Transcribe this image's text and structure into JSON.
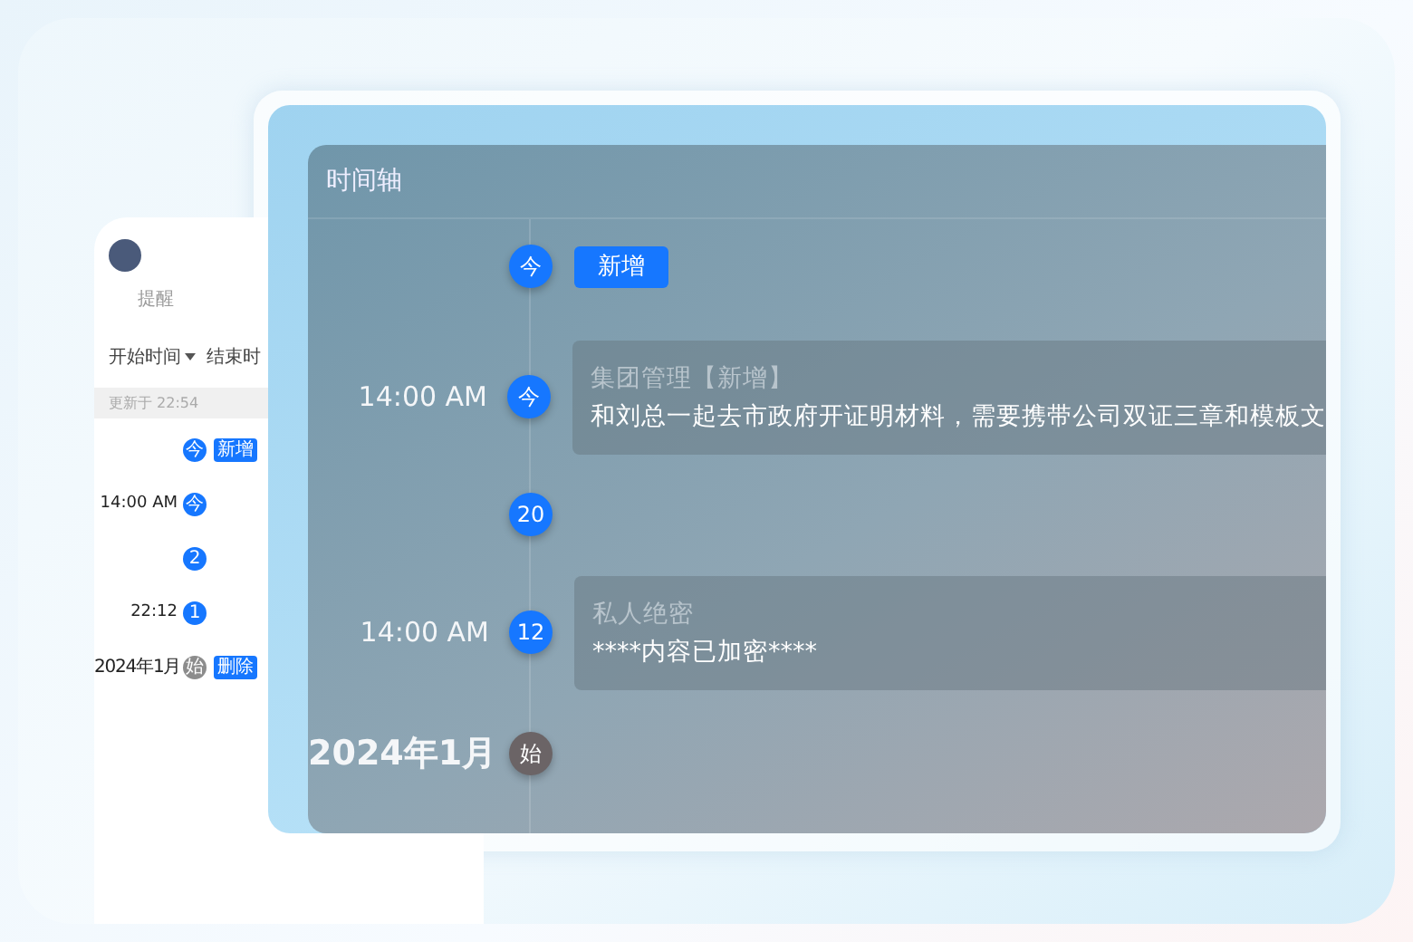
{
  "phone": {
    "tabs": [
      {
        "label": "提醒",
        "selected": false
      }
    ],
    "filters": [
      {
        "label": "开始时间",
        "dropdown": true
      },
      {
        "label": "结束时",
        "dropdown": false
      }
    ],
    "updated": "更新于 22:54",
    "items": [
      {
        "kind": "button",
        "node": "今",
        "color": "#1677ff",
        "label": "新增"
      },
      {
        "kind": "empty",
        "time": "14:00 AM",
        "node": "今",
        "color": "#1677ff"
      },
      {
        "kind": "empty",
        "node": "2",
        "color": "#1677ff"
      },
      {
        "kind": "empty",
        "time": "22:12",
        "node": "1",
        "color": "#1677ff"
      },
      {
        "kind": "button",
        "time": "2024年1月",
        "node": "始",
        "color": "#8c8c8c",
        "label": "删除"
      }
    ]
  },
  "timeline": {
    "title": "时间轴",
    "items": [
      {
        "kind": "button",
        "node": "今",
        "color": "#1677ff",
        "label": "新增"
      },
      {
        "kind": "card",
        "time": "14:00 AM",
        "node": "今",
        "color": "#1677ff",
        "title": "集团管理【新增】",
        "body": "和刘总一起去市政府开证明材料，需要携带公司双证三章和模板文"
      },
      {
        "kind": "empty",
        "node": "20",
        "color": "#1677ff"
      },
      {
        "kind": "card",
        "time": "14:00 AM",
        "node": "12",
        "color": "#1677ff",
        "title": "私人绝密",
        "body": "****内容已加密****"
      },
      {
        "kind": "start",
        "time": "2024年1月",
        "node": "始",
        "color": "#6b6466"
      }
    ]
  }
}
